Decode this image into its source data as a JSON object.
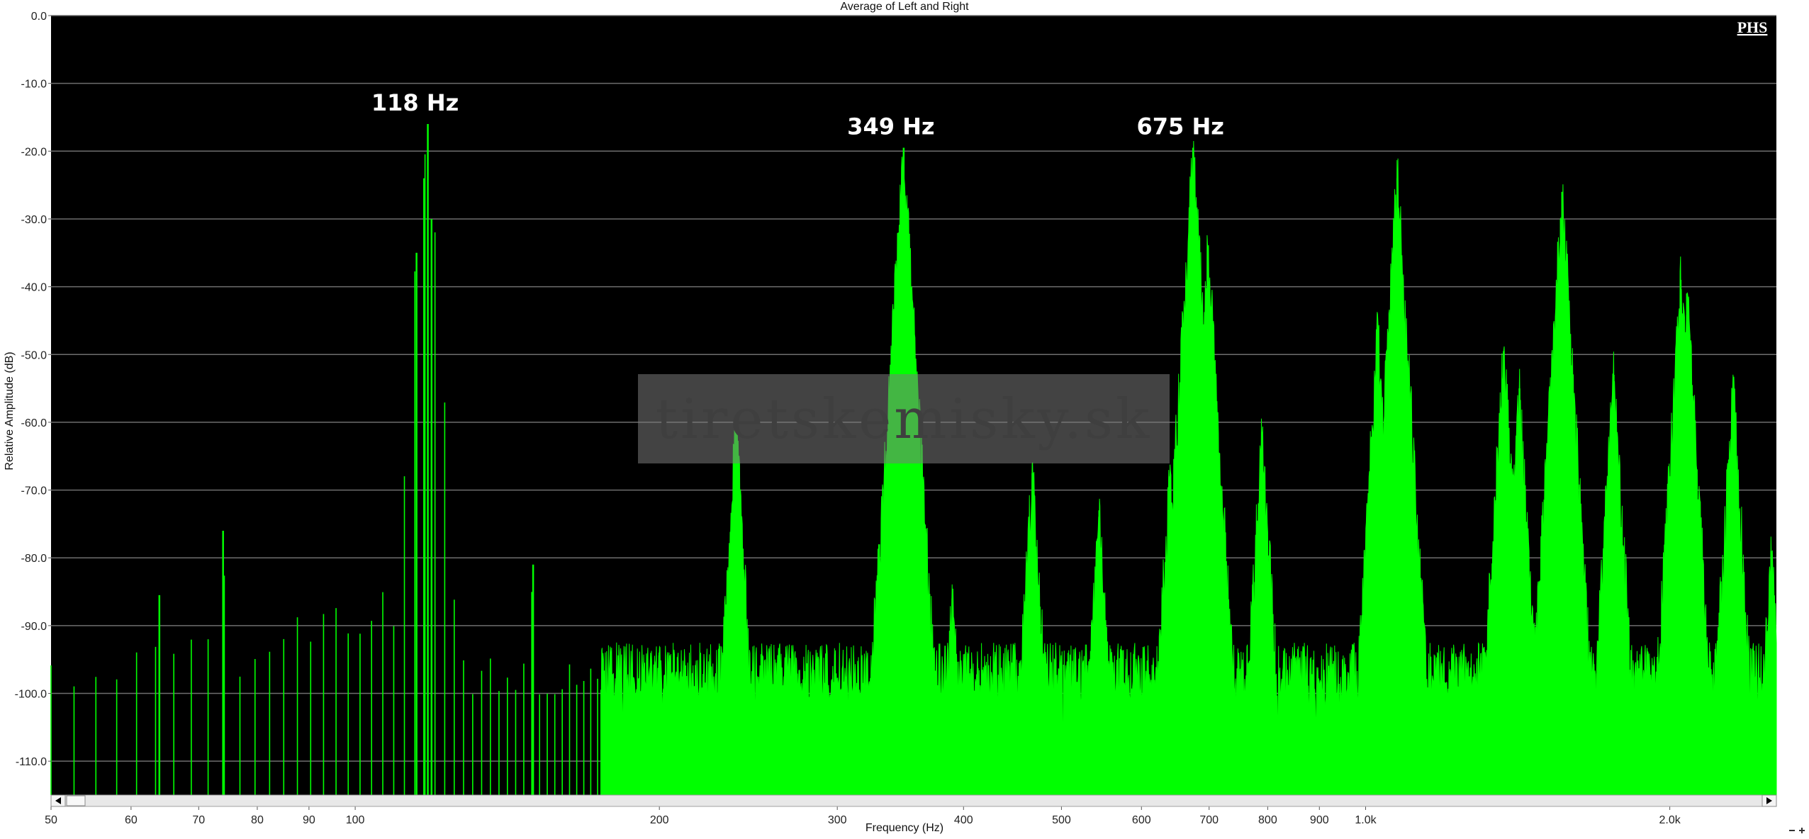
{
  "chart_data": {
    "type": "area",
    "title": "Average of Left and Right",
    "xlabel": "Frequency (Hz)",
    "ylabel": "Relative Amplitude (dB)",
    "x_scale": "log",
    "xlim": [
      50,
      2550
    ],
    "ylim": [
      -115,
      0
    ],
    "grid": "horizontal",
    "series_color": "#00ff00",
    "background_color": "#000000",
    "grid_color": "#6e6e6e",
    "y_ticks": [
      {
        "value": 0,
        "label": "0.0"
      },
      {
        "value": -10,
        "label": "-10.0"
      },
      {
        "value": -20,
        "label": "-20.0"
      },
      {
        "value": -30,
        "label": "-30.0"
      },
      {
        "value": -40,
        "label": "-40.0"
      },
      {
        "value": -50,
        "label": "-50.0"
      },
      {
        "value": -60,
        "label": "-60.0"
      },
      {
        "value": -70,
        "label": "-70.0"
      },
      {
        "value": -80,
        "label": "-80.0"
      },
      {
        "value": -90,
        "label": "-90.0"
      },
      {
        "value": -100,
        "label": "-100.0"
      },
      {
        "value": -110,
        "label": "-110.0"
      }
    ],
    "x_ticks": [
      {
        "value": 50,
        "label": "50"
      },
      {
        "value": 60,
        "label": "60"
      },
      {
        "value": 70,
        "label": "70"
      },
      {
        "value": 80,
        "label": "80"
      },
      {
        "value": 90,
        "label": "90"
      },
      {
        "value": 100,
        "label": "100"
      },
      {
        "value": 200,
        "label": "200"
      },
      {
        "value": 300,
        "label": "300"
      },
      {
        "value": 400,
        "label": "400"
      },
      {
        "value": 500,
        "label": "500"
      },
      {
        "value": 600,
        "label": "600"
      },
      {
        "value": 700,
        "label": "700"
      },
      {
        "value": 800,
        "label": "800"
      },
      {
        "value": 900,
        "label": "900"
      },
      {
        "value": 1000,
        "label": "1.0k"
      },
      {
        "value": 2000,
        "label": "2.0k"
      }
    ],
    "annotations": [
      {
        "text": "118 Hz",
        "x": 118,
        "y": -14
      },
      {
        "text": "349 Hz",
        "x": 349,
        "y": -17.5
      },
      {
        "text": "675 Hz",
        "x": 675,
        "y": -17.5
      }
    ],
    "noise_floor_db": -97,
    "peaks": [
      {
        "x": 64,
        "y": -85.5
      },
      {
        "x": 74,
        "y": -76
      },
      {
        "x": 115,
        "y": -35
      },
      {
        "x": 117,
        "y": -24
      },
      {
        "x": 118,
        "y": -16
      },
      {
        "x": 119,
        "y": -30
      },
      {
        "x": 150,
        "y": -81
      },
      {
        "x": 200,
        "y": -94
      },
      {
        "x": 235,
        "y": -79
      },
      {
        "x": 238,
        "y": -60.5
      },
      {
        "x": 330,
        "y": -78
      },
      {
        "x": 345,
        "y": -32
      },
      {
        "x": 349,
        "y": -19.5
      },
      {
        "x": 352,
        "y": -45
      },
      {
        "x": 390,
        "y": -86
      },
      {
        "x": 468,
        "y": -67.5
      },
      {
        "x": 545,
        "y": -73
      },
      {
        "x": 640,
        "y": -68
      },
      {
        "x": 668,
        "y": -58
      },
      {
        "x": 675,
        "y": -19.5
      },
      {
        "x": 680,
        "y": -31.5
      },
      {
        "x": 698,
        "y": -34
      },
      {
        "x": 790,
        "y": -61.5
      },
      {
        "x": 1028,
        "y": -46.5
      },
      {
        "x": 1070,
        "y": -28.5
      },
      {
        "x": 1075,
        "y": -24
      },
      {
        "x": 1370,
        "y": -49.5
      },
      {
        "x": 1420,
        "y": -55
      },
      {
        "x": 1560,
        "y": -30
      },
      {
        "x": 1565,
        "y": -26
      },
      {
        "x": 1760,
        "y": -53
      },
      {
        "x": 2050,
        "y": -39
      },
      {
        "x": 2080,
        "y": -41
      },
      {
        "x": 2310,
        "y": -55
      },
      {
        "x": 2520,
        "y": -79
      }
    ]
  },
  "watermark": "tiretskemisky.sk",
  "badge": "PHS"
}
